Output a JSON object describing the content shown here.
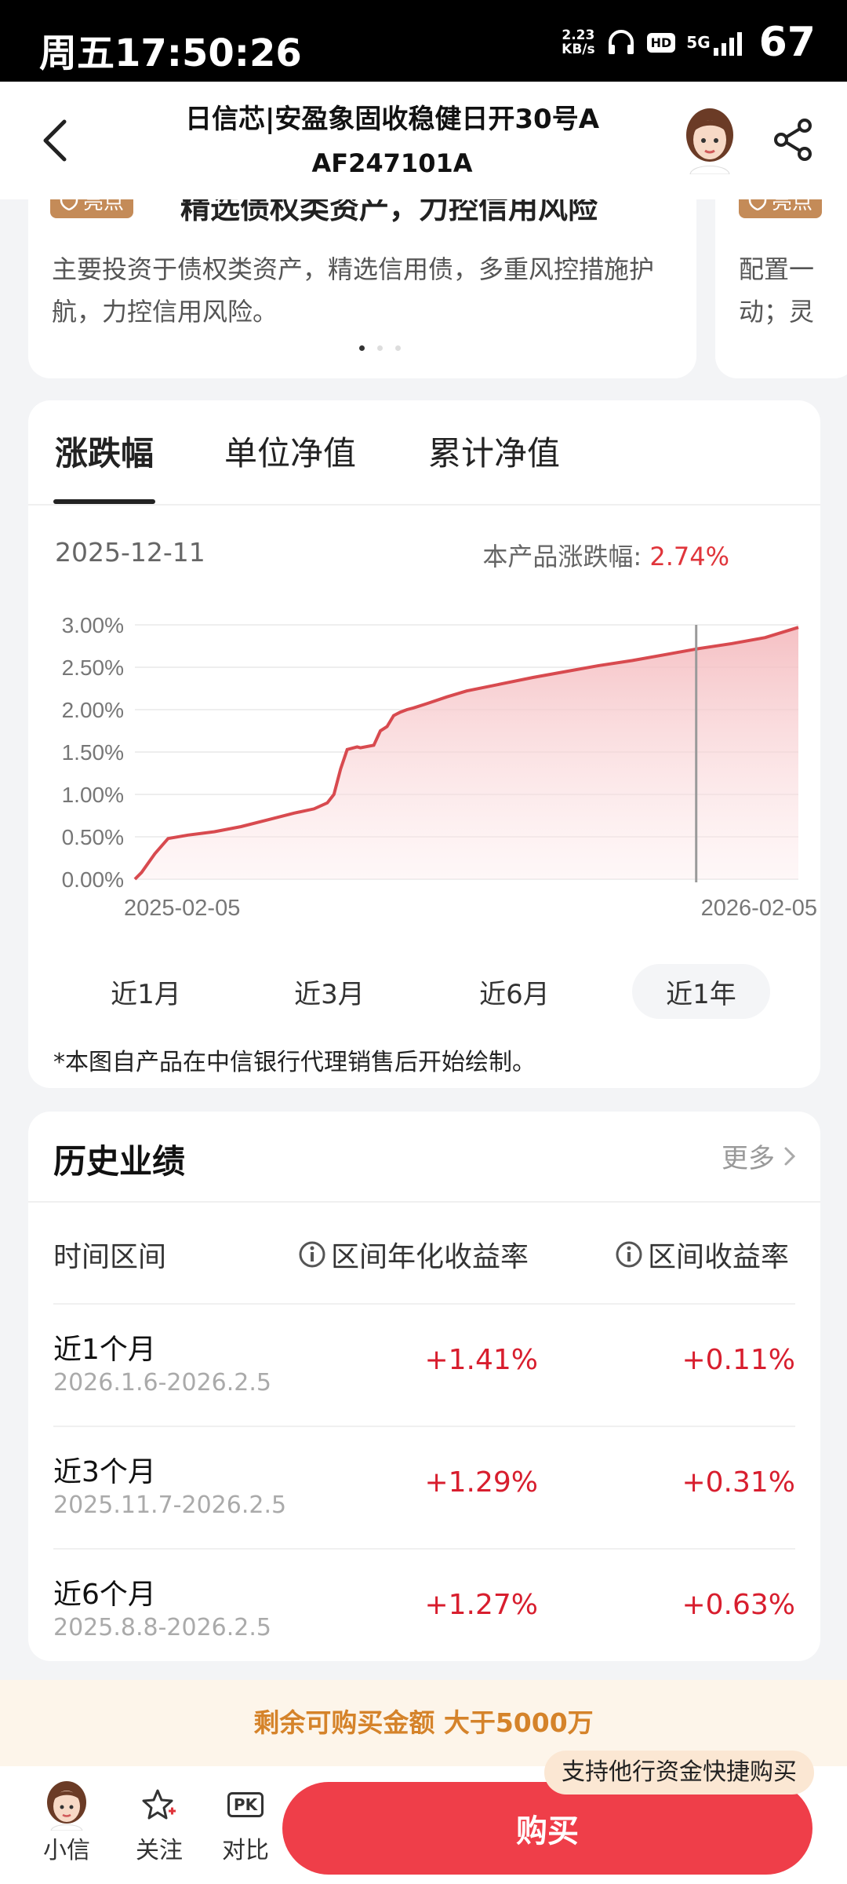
{
  "status_bar": {
    "time": "周五17:50:26",
    "net_speed_value": "2.23",
    "net_speed_unit": "KB/s",
    "hd": "HD",
    "network": "5G",
    "battery": "67"
  },
  "header": {
    "title_line1": "日信芯|安盈象固收稳健日开30号A",
    "title_line2": "AF247101A"
  },
  "highlights": [
    {
      "badge": "亮点",
      "heading": "精选债权类资产，力控信用风险",
      "body": "主要投资于债权类资产，精选信用债，多重风控措施护航，力控信用风险。"
    },
    {
      "badge": "亮点",
      "body_line1": "配置一",
      "body_line2": "动；灵"
    }
  ],
  "chart_tabs": [
    "涨跌幅",
    "单位净值",
    "累计净值"
  ],
  "chart_info": {
    "date": "2025-12-11",
    "change_label": "本产品涨跌幅: ",
    "change_value": "2.74%"
  },
  "chart_data": {
    "type": "area",
    "x_start": "2025-02-05",
    "x_end": "2026-02-05",
    "y_ticks": [
      "0.00%",
      "0.50%",
      "1.00%",
      "1.50%",
      "2.00%",
      "2.50%",
      "3.00%"
    ],
    "ylim": [
      0,
      3
    ],
    "x": [
      0,
      0.01,
      0.03,
      0.05,
      0.08,
      0.12,
      0.16,
      0.2,
      0.24,
      0.27,
      0.29,
      0.3,
      0.31,
      0.32,
      0.33,
      0.335,
      0.34,
      0.36,
      0.37,
      0.38,
      0.39,
      0.4,
      0.41,
      0.42,
      0.44,
      0.47,
      0.5,
      0.55,
      0.6,
      0.65,
      0.7,
      0.75,
      0.8,
      0.85,
      0.9,
      0.95,
      1.0
    ],
    "values": [
      0.0,
      0.08,
      0.3,
      0.48,
      0.52,
      0.56,
      0.62,
      0.7,
      0.78,
      0.83,
      0.9,
      1.0,
      1.3,
      1.53,
      1.55,
      1.56,
      1.55,
      1.58,
      1.75,
      1.8,
      1.93,
      1.97,
      2.0,
      2.02,
      2.07,
      2.15,
      2.22,
      2.3,
      2.38,
      2.45,
      2.52,
      2.58,
      2.65,
      2.72,
      2.78,
      2.85,
      2.97
    ],
    "cursor_x": 0.846,
    "line_color": "#d84a4f",
    "fill_color": "#f6c9cc"
  },
  "range_buttons": [
    "近1月",
    "近3月",
    "近6月",
    "近1年"
  ],
  "chart_note": "*本图自产品在中信银行代理销售后开始绘制。",
  "history": {
    "title": "历史业绩",
    "more": "更多",
    "col_period": "时间区间",
    "col_annual": "区间年化收益率",
    "col_return": "区间收益率",
    "rows": [
      {
        "label": "近1个月",
        "range": "2026.1.6-2026.2.5",
        "annual": "+1.41%",
        "ret": "+0.11%"
      },
      {
        "label": "近3个月",
        "range": "2025.11.7-2026.2.5",
        "annual": "+1.29%",
        "ret": "+0.31%"
      },
      {
        "label": "近6个月",
        "range": "2025.8.8-2026.2.5",
        "annual": "+1.27%",
        "ret": "+0.63%"
      }
    ]
  },
  "quota": "剩余可购买金额  大于5000万",
  "tooltip": "支持他行资金快捷购买",
  "bottom_bar": {
    "assistant": "小信",
    "follow": "关注",
    "compare_badge": "PK",
    "compare": "对比",
    "buy": "购买"
  }
}
